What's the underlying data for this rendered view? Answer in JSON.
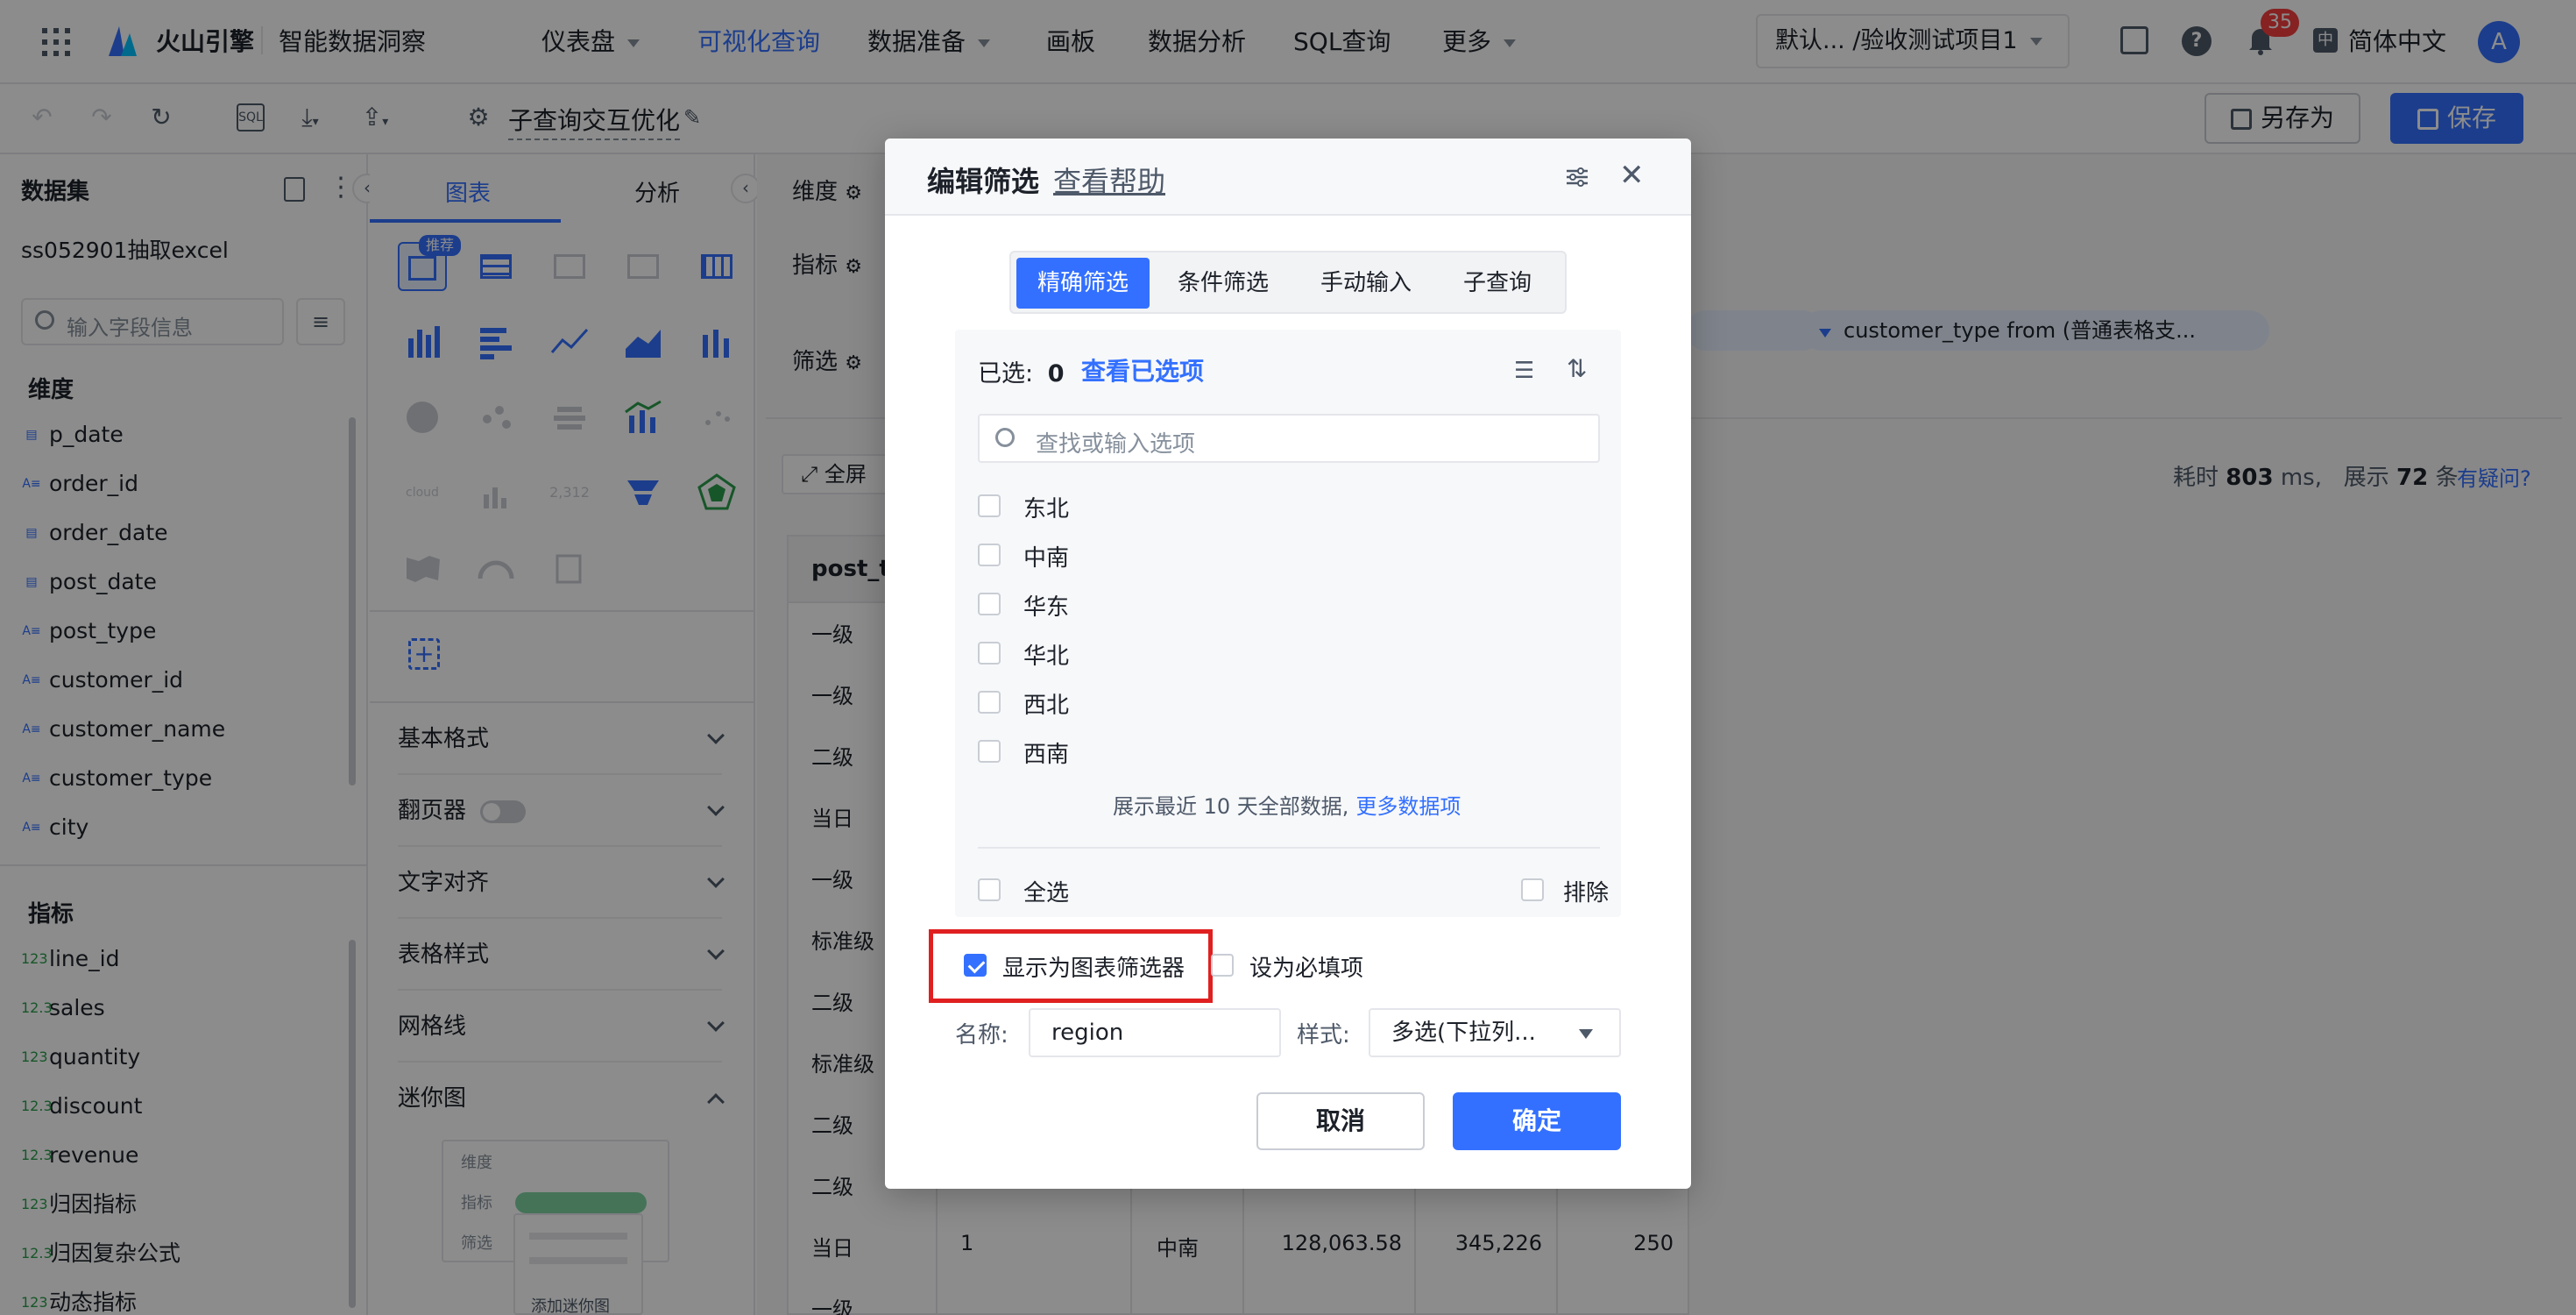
{
  "topbar": {
    "brand": "火山引擎",
    "product": "智能数据洞察",
    "nav": [
      "仪表盘",
      "可视化查询",
      "数据准备",
      "画板",
      "数据分析",
      "SQL查询",
      "更多"
    ],
    "project": "默认... /验收测试项目1",
    "badge_count": "35",
    "language": "简体中文",
    "avatar": "A"
  },
  "toolbar": {
    "title": "子查询交互优化",
    "save_as": "另存为",
    "save": "保存"
  },
  "left": {
    "header": "数据集",
    "dataset": "ss052901抽取excel",
    "search_placeholder": "输入字段信息",
    "dim_header": "维度",
    "dims": [
      "p_date",
      "order_id",
      "order_date",
      "post_date",
      "post_type",
      "customer_id",
      "customer_name",
      "customer_type",
      "city"
    ],
    "mea_header": "指标",
    "meas": [
      "line_id",
      "sales",
      "quantity",
      "discount",
      "revenue",
      "归因指标",
      "归因复杂公式",
      "动态指标"
    ]
  },
  "mid": {
    "tab_chart": "图表",
    "tab_analysis": "分析",
    "recommend": "推荐",
    "accordions": [
      "基本格式",
      "翻页器",
      "文字对齐",
      "表格样式",
      "网格线",
      "迷你图"
    ],
    "mini_rows": [
      "维度",
      "指标",
      "筛选"
    ],
    "mini_add": "添加迷你图"
  },
  "right": {
    "dim_label": "维度",
    "mea_label": "指标",
    "filter_label": "筛选",
    "filter_chip": "customer_type from (普通表格支...",
    "fullscreen": "全屏",
    "stats_time_label": "耗时",
    "stats_time": "803",
    "stats_time_unit": "ms,",
    "stats_count_label": "展示",
    "stats_count": "72",
    "stats_count_unit": "条",
    "question": "有疑问?",
    "col_header": "post_ty",
    "rows": [
      "一级",
      "一级",
      "二级",
      "当日",
      "一级",
      "标准级",
      "二级",
      "标准级",
      "二级",
      "二级",
      "当日",
      "一级"
    ],
    "last_row": {
      "c1": "当日",
      "c2": "1",
      "c3": "中南",
      "c4": "128,063.58",
      "c5": "345,226",
      "c6": "250"
    }
  },
  "modal": {
    "title": "编辑筛选",
    "help": "查看帮助",
    "tabs": [
      "精确筛选",
      "条件筛选",
      "手动输入",
      "子查询"
    ],
    "selected_label": "已选:",
    "selected_count": "0",
    "view_selected": "查看已选项",
    "search_placeholder": "查找或输入选项",
    "options": [
      "东北",
      "中南",
      "华东",
      "华北",
      "西北",
      "西南"
    ],
    "hint": "展示最近 10 天全部数据,",
    "more": "更多数据项",
    "select_all": "全选",
    "exclude": "排除",
    "show_as_filter": "显示为图表筛选器",
    "required": "设为必填项",
    "name_label": "名称:",
    "name_value": "region",
    "style_label": "样式:",
    "style_value": "多选(下拉列...",
    "cancel": "取消",
    "ok": "确定"
  },
  "colors": {
    "accent": "#3370ff",
    "highlight": "#e02020",
    "badge": "#f53f3f"
  }
}
